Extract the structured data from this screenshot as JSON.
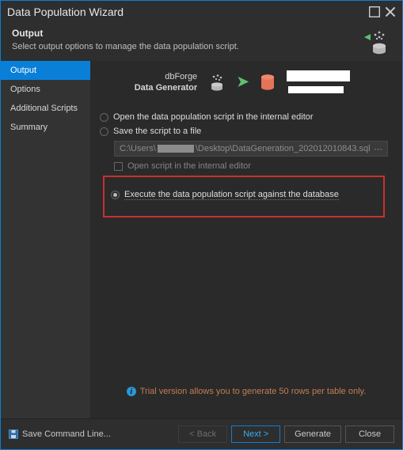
{
  "window": {
    "title": "Data Population Wizard"
  },
  "subheader": {
    "title": "Output",
    "desc": "Select output options to manage the data population script."
  },
  "sidebar": {
    "items": [
      {
        "label": "Output",
        "active": true
      },
      {
        "label": "Options",
        "active": false
      },
      {
        "label": "Additional Scripts",
        "active": false
      },
      {
        "label": "Summary",
        "active": false
      }
    ]
  },
  "flow": {
    "line1": "dbForge",
    "line2": "Data Generator"
  },
  "options": {
    "openEditor": "Open the data population script in the internal editor",
    "saveFile": "Save the script to a file",
    "path_prefix": "C:\\Users\\",
    "path_suffix": "\\Desktop\\DataGeneration_202012010843.sql",
    "openAfterSave": "Open script in the internal editor",
    "execute": "Execute the data population script against the database"
  },
  "trial": {
    "text": "Trial version allows you to generate 50 rows per table only."
  },
  "footer": {
    "savecmd": "Save Command Line...",
    "back": "< Back",
    "next": "Next >",
    "generate": "Generate",
    "close": "Close"
  }
}
